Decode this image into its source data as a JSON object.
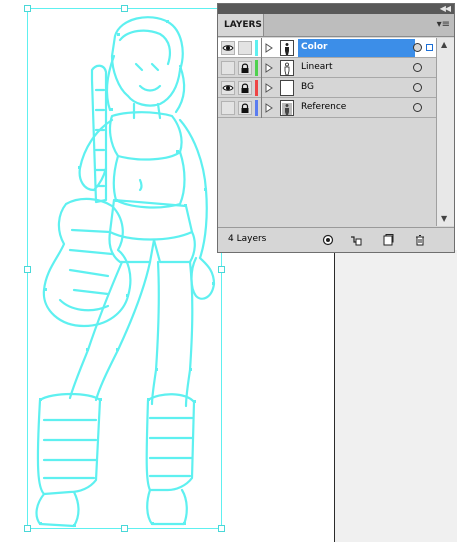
{
  "panel": {
    "tab_label": "LAYERS",
    "collapse_icon": "double-chevron-left-icon",
    "menu_icon": "panel-menu-icon",
    "layer_count": "4 Layers",
    "layers": [
      {
        "name": "Color",
        "visible": true,
        "locked": false,
        "color": "#5ef0f0",
        "selected": true
      },
      {
        "name": "Lineart",
        "visible": false,
        "locked": true,
        "color": "#4fd14f",
        "selected": false
      },
      {
        "name": "BG",
        "visible": true,
        "locked": true,
        "color": "#ee4444",
        "selected": false
      },
      {
        "name": "Reference",
        "visible": false,
        "locked": true,
        "color": "#5a7cf0",
        "selected": false
      }
    ],
    "footer_buttons": [
      "make-clipping-mask-icon",
      "create-sublayer-icon",
      "create-layer-icon",
      "delete-layer-icon"
    ]
  },
  "colors": {
    "selection": "#5ef0f0",
    "highlight": "#3c8ee8"
  }
}
